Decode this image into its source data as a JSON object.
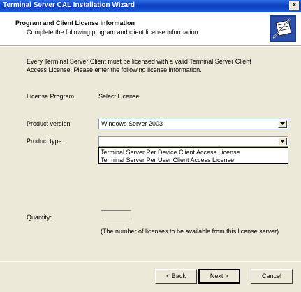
{
  "window": {
    "title": "Terminal Server CAL Installation Wizard",
    "close_glyph": "×"
  },
  "header": {
    "title": "Program and Client License Information",
    "subtitle": "Complete the following program and client license information.",
    "icon": "wizard-license-icon"
  },
  "body": {
    "intro_line1": "Every Terminal Server Client must be licensed with a valid Terminal Server Client",
    "intro_line2": "Access License. Please enter the following license information.",
    "license_program_label": "License Program",
    "license_program_value": "Select License",
    "product_version_label": "Product version",
    "product_version_value": "Windows Server 2003",
    "product_type_label": "Product type:",
    "product_type_value": "",
    "product_type_options": [
      "Terminal Server Per Device Client Access License",
      "Terminal Server Per User Client Access License"
    ],
    "quantity_label": "Quantity:",
    "quantity_value": "",
    "quantity_hint": "(The number of licenses to be available from this license server)"
  },
  "buttons": {
    "back": "< Back",
    "next": "Next >",
    "cancel": "Cancel"
  },
  "colors": {
    "titlebar": "#0a3fc0",
    "dialog_bg": "#ece9d8",
    "header_bg": "#ffffff"
  }
}
